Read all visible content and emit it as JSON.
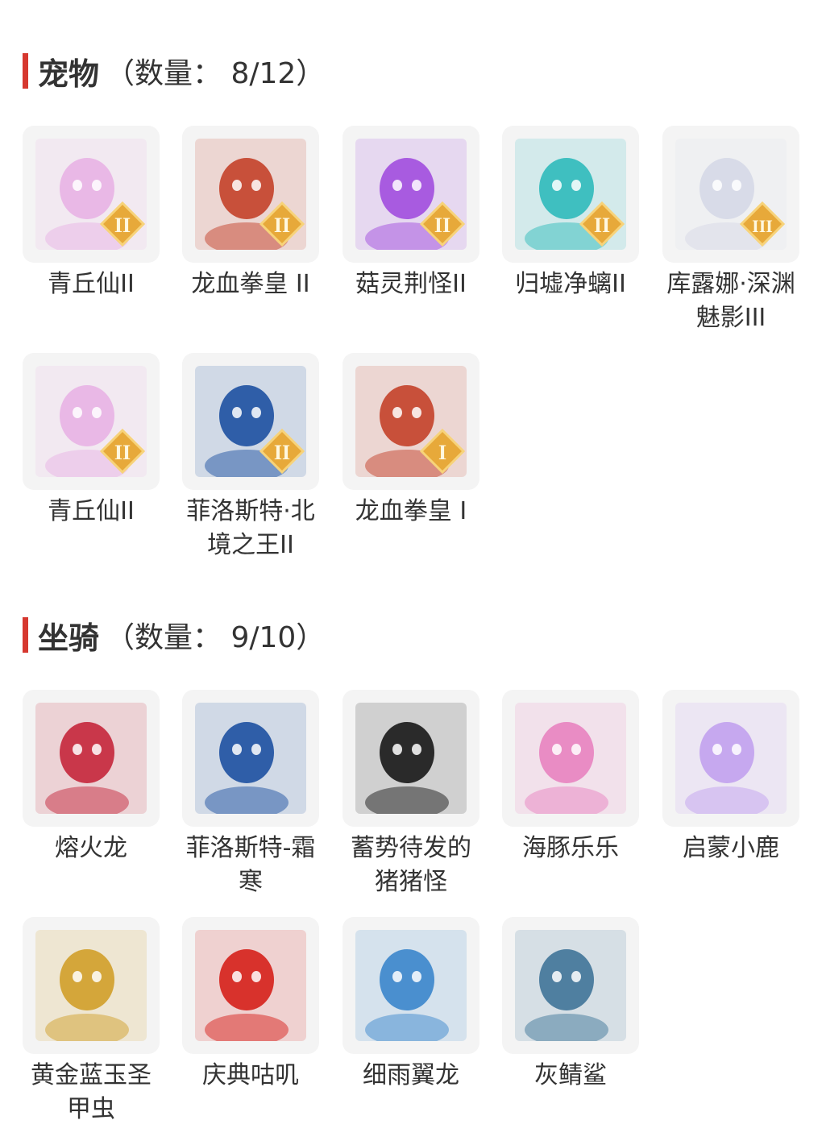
{
  "sections": [
    {
      "name": "宠物",
      "count_text": "（数量： 8/12）",
      "items": [
        {
          "name": "青丘仙II",
          "icon": "fox-fairy-portrait",
          "tier": "II",
          "color": "#e9b8e6"
        },
        {
          "name": "龙血拳皇 II",
          "icon": "ram-demon-portrait",
          "tier": "II",
          "color": "#c8503a"
        },
        {
          "name": "菇灵荆怪II",
          "icon": "mushroom-sprite-portrait",
          "tier": "II",
          "color": "#a85be0"
        },
        {
          "name": "归墟净螭II",
          "icon": "jade-dragon-portrait",
          "tier": "II",
          "color": "#3fbfc0"
        },
        {
          "name": "库露娜·深渊魅影III",
          "icon": "abyss-phantom-portrait",
          "tier": "III",
          "color": "#d8dbe8"
        },
        {
          "name": "青丘仙II",
          "icon": "fox-fairy-portrait",
          "tier": "II",
          "color": "#e9b8e6"
        },
        {
          "name": "菲洛斯特·北境之王II",
          "icon": "frost-king-portrait",
          "tier": "II",
          "color": "#2f5ea8"
        },
        {
          "name": "龙血拳皇 I",
          "icon": "ram-demon-portrait",
          "tier": "I",
          "color": "#c8503a"
        }
      ]
    },
    {
      "name": "坐骑",
      "count_text": "（数量： 9/10）",
      "items": [
        {
          "name": "熔火龙",
          "icon": "magma-dragon-portrait",
          "color": "#c9374a"
        },
        {
          "name": "菲洛斯特-霜寒",
          "icon": "frost-king-portrait",
          "color": "#2f5ea8"
        },
        {
          "name": "蓄势待发的猪猪怪",
          "icon": "pig-monster-portrait",
          "color": "#2a2a2a"
        },
        {
          "name": "海豚乐乐",
          "icon": "dolphin-portrait",
          "color": "#e98cc4"
        },
        {
          "name": "启蒙小鹿",
          "icon": "spirit-deer-portrait",
          "color": "#c6a8ef"
        },
        {
          "name": "黄金蓝玉圣甲虫",
          "icon": "golden-scarab-portrait",
          "color": "#d4a63a"
        },
        {
          "name": "庆典咕叽",
          "icon": "festival-bird-portrait",
          "color": "#d8322c"
        },
        {
          "name": "细雨翼龙",
          "icon": "pterosaur-portrait",
          "color": "#4a8fcf"
        },
        {
          "name": "灰鲭鲨",
          "icon": "shark-portrait",
          "color": "#4f7fa0"
        }
      ]
    }
  ]
}
